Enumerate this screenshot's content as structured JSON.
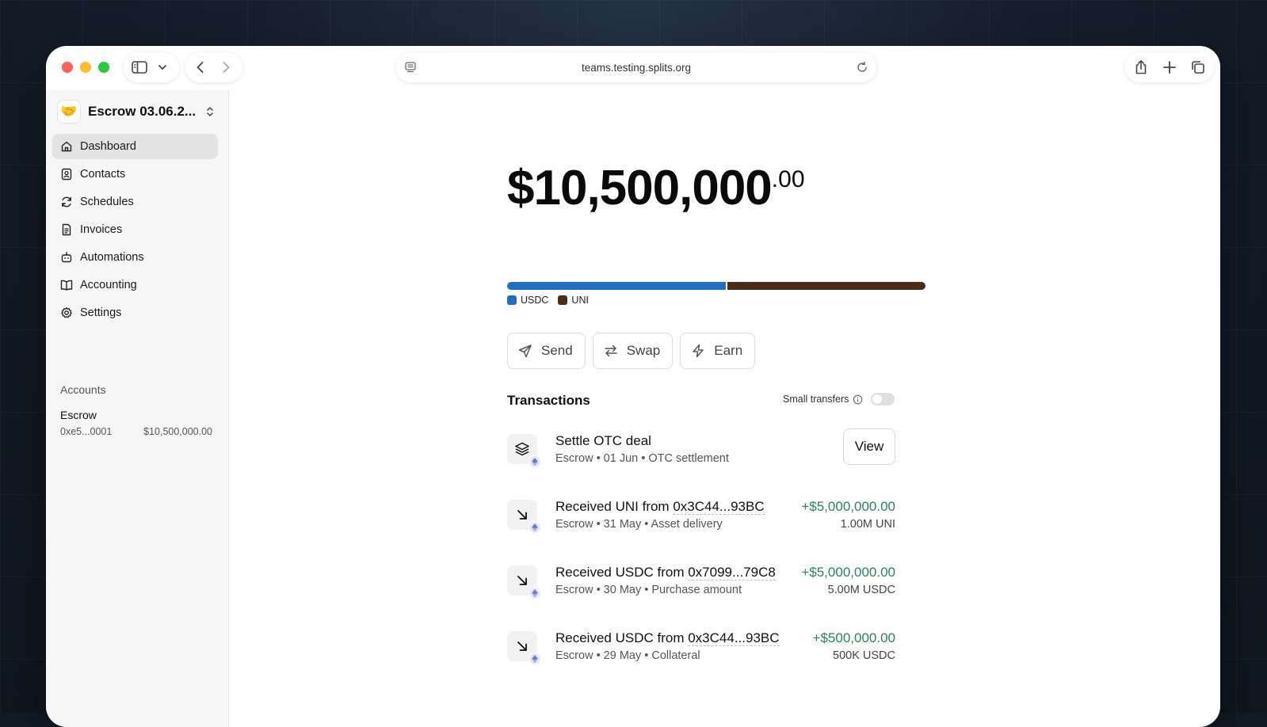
{
  "browser": {
    "url": "teams.testing.splits.org"
  },
  "sidebar": {
    "workspace_name": "Escrow 03.06.2...",
    "nav": [
      {
        "label": "Dashboard",
        "icon": "home-icon",
        "active": true
      },
      {
        "label": "Contacts",
        "icon": "contacts-icon",
        "active": false
      },
      {
        "label": "Schedules",
        "icon": "refresh-icon",
        "active": false
      },
      {
        "label": "Invoices",
        "icon": "document-icon",
        "active": false
      },
      {
        "label": "Automations",
        "icon": "bot-icon",
        "active": false
      },
      {
        "label": "Accounting",
        "icon": "book-icon",
        "active": false
      },
      {
        "label": "Settings",
        "icon": "gear-icon",
        "active": false
      }
    ],
    "accounts_title": "Accounts",
    "account": {
      "name": "Escrow",
      "address": "0xe5...0001",
      "balance": "$10,500,000.00"
    }
  },
  "main": {
    "balance_whole": "$10,500,000",
    "balance_cents": ".00",
    "allocation": [
      {
        "label": "USDC",
        "share": 0.524,
        "color": "#1f6fc5"
      },
      {
        "label": "UNI",
        "share": 0.476,
        "color": "#4a2d14"
      }
    ],
    "actions": {
      "send": "Send",
      "swap": "Swap",
      "earn": "Earn"
    },
    "transactions_title": "Transactions",
    "small_transfers_label": "Small transfers",
    "small_transfers_enabled": false,
    "transactions": [
      {
        "title": "Settle OTC deal",
        "subtitle": "Escrow • 01 Jun • OTC settlement",
        "button": "View",
        "icon": "layers-icon"
      },
      {
        "title_prefix": "Received UNI from ",
        "address": "0x3C44...93BC",
        "subtitle": "Escrow • 31 May • Asset delivery",
        "amount": "+$5,000,000.00",
        "amount_sub": "1.00M UNI",
        "icon": "arrow-down-right-icon"
      },
      {
        "title_prefix": "Received USDC from ",
        "address": "0x7099...79C8",
        "subtitle": "Escrow • 30 May • Purchase amount",
        "amount": "+$5,000,000.00",
        "amount_sub": "5.00M USDC",
        "icon": "arrow-down-right-icon"
      },
      {
        "title_prefix": "Received USDC from ",
        "address": "0x3C44...93BC",
        "subtitle": "Escrow • 29 May • Collateral",
        "amount": "+$500,000.00",
        "amount_sub": "500K USDC",
        "icon": "arrow-down-right-icon"
      }
    ]
  }
}
